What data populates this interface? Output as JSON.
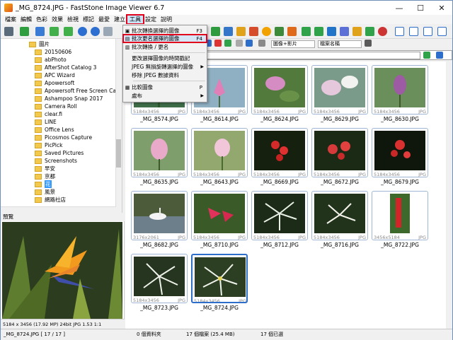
{
  "window": {
    "title": "_MG_8724.JPG  -  FastStone Image Viewer 6.7",
    "minimize": "—",
    "maximize": "☐",
    "close": "✕"
  },
  "menu": [
    {
      "label": "檔案"
    },
    {
      "label": "編輯"
    },
    {
      "label": "色彩"
    },
    {
      "label": "效果"
    },
    {
      "label": "檢視"
    },
    {
      "label": "標記"
    },
    {
      "label": "最愛"
    },
    {
      "label": "建立"
    },
    {
      "label": "工具"
    },
    {
      "label": "設定"
    },
    {
      "label": "說明"
    }
  ],
  "tools_menu": {
    "items": [
      {
        "label": "批次轉換選擇的圖像",
        "shortcut": "F3"
      },
      {
        "label": "批次更名選擇的圖像",
        "shortcut": "F4",
        "highlight": true
      },
      {
        "label": "批次轉換 / 更名",
        "shortcut": ""
      },
      {
        "label": "更改選擇圖像的時間戳記",
        "shortcut": ""
      },
      {
        "label": "JPEG 無損旋轉選擇的圖像",
        "shortcut": "",
        "submenu": true
      },
      {
        "label": "移除 JPEG 數據資料",
        "shortcut": ""
      },
      {
        "label": "比較圖像",
        "shortcut": "P"
      },
      {
        "label": "處布",
        "shortcut": "",
        "submenu": true
      }
    ]
  },
  "tree": {
    "items": [
      {
        "label": "圖片"
      },
      {
        "label": "20150606"
      },
      {
        "label": "abPhoto"
      },
      {
        "label": "AfterShot Catalog 3"
      },
      {
        "label": "APC Wizard"
      },
      {
        "label": "Apowersoft"
      },
      {
        "label": "Apowersoft Free Screen Capt"
      },
      {
        "label": "Ashampoo Snap 2017"
      },
      {
        "label": "Camera Roll"
      },
      {
        "label": "clear.fi"
      },
      {
        "label": "LINE"
      },
      {
        "label": "Office Lens"
      },
      {
        "label": "Picosmos Capture"
      },
      {
        "label": "PicPick"
      },
      {
        "label": "Saved Pictures"
      },
      {
        "label": "Screenshots"
      },
      {
        "label": "早安"
      },
      {
        "label": "京都"
      },
      {
        "label": "花",
        "selected": true
      },
      {
        "label": "風景"
      },
      {
        "label": "網路社店"
      }
    ]
  },
  "preview": {
    "header": "預覽",
    "info": "5184 x 3456 (17.92 MP)  24bit  JPG  1.53  1:1"
  },
  "view_options": {
    "display": "圖像+影片",
    "sort": "檔案名稱"
  },
  "thumbnails": [
    {
      "name": "_MG_8574.JPG",
      "dims": "5184x3456",
      "type": "JPG"
    },
    {
      "name": "_MG_8614.JPG",
      "dims": "5184x3456",
      "type": "JPG"
    },
    {
      "name": "_MG_8624.JPG",
      "dims": "5184x3456",
      "type": "JPG"
    },
    {
      "name": "_MG_8629.JPG",
      "dims": "5184x3456",
      "type": "JPG"
    },
    {
      "name": "_MG_8630.JPG",
      "dims": "5184x3456",
      "type": "JPG"
    },
    {
      "name": "_MG_8635.JPG",
      "dims": "5184x3456",
      "type": "JPG"
    },
    {
      "name": "_MG_8643.JPG",
      "dims": "5184x3456",
      "type": "JPG"
    },
    {
      "name": "_MG_8669.JPG",
      "dims": "5184x3456",
      "type": "JPG"
    },
    {
      "name": "_MG_8672.JPG",
      "dims": "5184x3456",
      "type": "JPG"
    },
    {
      "name": "_MG_8679.JPG",
      "dims": "5184x3456",
      "type": "JPG"
    },
    {
      "name": "_MG_8682.JPG",
      "dims": "3176x2061",
      "type": "JPG"
    },
    {
      "name": "_MG_8710.JPG",
      "dims": "5184x3456",
      "type": "JPG"
    },
    {
      "name": "_MG_8712.JPG",
      "dims": "5184x3456",
      "type": "JPG"
    },
    {
      "name": "_MG_8716.JPG",
      "dims": "5184x3456",
      "type": "JPG"
    },
    {
      "name": "_MG_8722.JPG",
      "dims": "3456x5184",
      "type": "JPG"
    },
    {
      "name": "_MG_8723.JPG",
      "dims": "5184x3456",
      "type": "JPG"
    },
    {
      "name": "_MG_8724.JPG",
      "dims": "5184x3456",
      "type": "JPG",
      "selected": true
    }
  ],
  "status": {
    "current": "_MG_8724.JPG [ 17 / 17 ]",
    "folders": "0 個資料夾",
    "files": "17 個檔案 (25.4 MB)",
    "selected": "17 個已選"
  }
}
